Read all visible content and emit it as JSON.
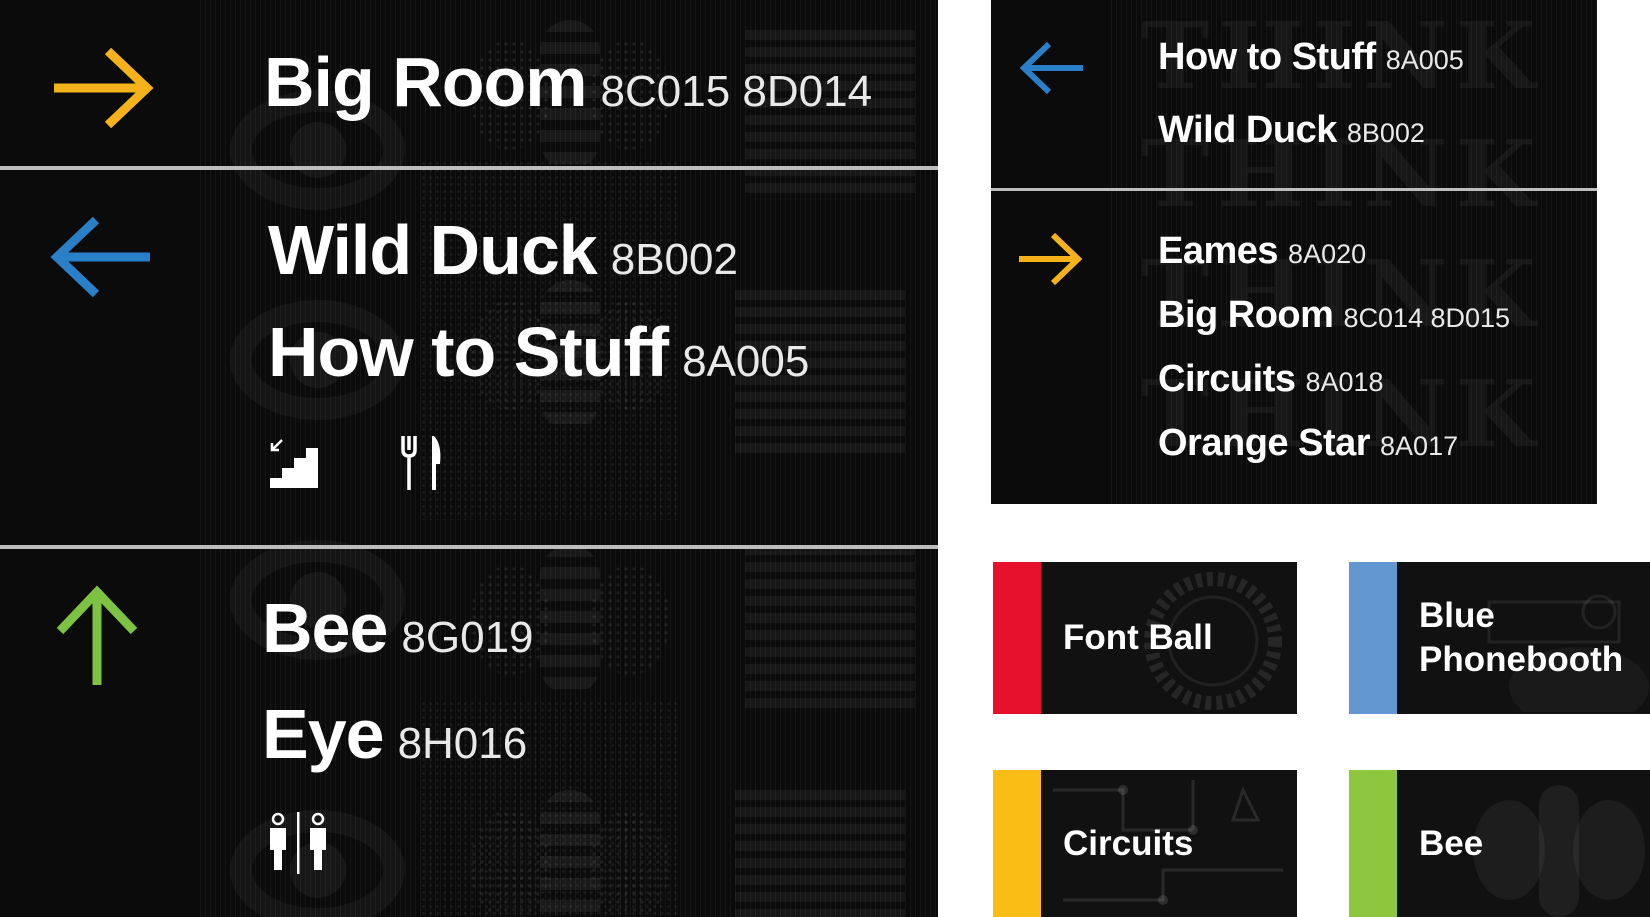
{
  "main_sign": {
    "section1": {
      "arrow": "arrow-right-icon",
      "arrow_color": "#F5B21B",
      "destinations": [
        {
          "name": "Big Room",
          "code": "8C015 8D014"
        }
      ]
    },
    "section2": {
      "arrow": "arrow-left-icon",
      "arrow_color": "#2A7FC9",
      "destinations": [
        {
          "name": "Wild Duck",
          "code": "8B002"
        },
        {
          "name": "How to Stuff",
          "code": "8A005"
        }
      ],
      "pictograms": [
        "stairs-down-icon",
        "restaurant-icon"
      ]
    },
    "section3": {
      "arrow": "arrow-up-icon",
      "arrow_color": "#7DC242",
      "destinations": [
        {
          "name": "Bee",
          "code": "8G019"
        },
        {
          "name": "Eye",
          "code": "8H016"
        }
      ],
      "pictograms": [
        "restroom-icon"
      ]
    }
  },
  "directory_sign": {
    "section1": {
      "arrow": "arrow-left-icon",
      "arrow_color": "#2A7FC9",
      "destinations": [
        {
          "name": "How to Stuff",
          "code": "8A005"
        },
        {
          "name": "Wild Duck",
          "code": "8B002"
        }
      ]
    },
    "section2": {
      "arrow": "arrow-right-icon",
      "arrow_color": "#F5B21B",
      "destinations": [
        {
          "name": "Eames",
          "code": "8A020"
        },
        {
          "name": "Big Room",
          "code": "8C014 8D015"
        },
        {
          "name": "Circuits",
          "code": "8A018"
        },
        {
          "name": "Orange Star",
          "code": "8A017"
        }
      ]
    },
    "background_watermark": "THINK"
  },
  "room_tiles": [
    {
      "label": "Font Ball",
      "color": "#E8112D"
    },
    {
      "label": "Blue\nPhonebooth",
      "color": "#6196CF"
    },
    {
      "label": "Circuits",
      "color": "#F9BD16"
    },
    {
      "label": "Bee",
      "color": "#8DC63F"
    }
  ]
}
